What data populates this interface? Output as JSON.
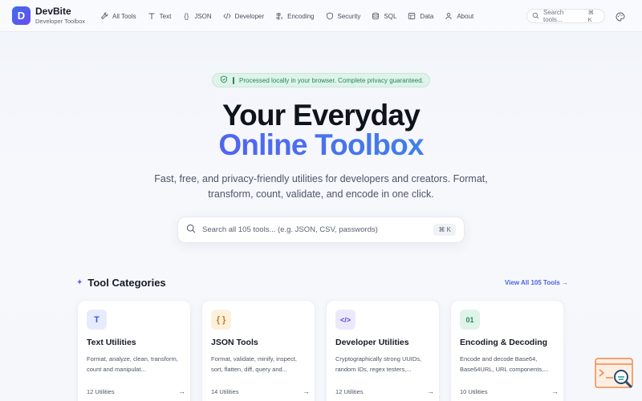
{
  "brand": {
    "logo_letter": "D",
    "name": "DevBite",
    "subtitle": "Developer Toolbox"
  },
  "nav": [
    {
      "label": "All Tools",
      "icon": "wrench-icon"
    },
    {
      "label": "Text",
      "icon": "text-icon"
    },
    {
      "label": "JSON",
      "icon": "braces-icon"
    },
    {
      "label": "Developer",
      "icon": "code-icon"
    },
    {
      "label": "Encoding",
      "icon": "binary-icon"
    },
    {
      "label": "Security",
      "icon": "shield-icon"
    },
    {
      "label": "SQL",
      "icon": "database-icon"
    },
    {
      "label": "Data",
      "icon": "table-icon"
    },
    {
      "label": "About",
      "icon": "user-icon"
    }
  ],
  "header_search": {
    "placeholder": "Search tools...",
    "shortcut": "⌘ K"
  },
  "hero": {
    "badge": "Processed locally in your browser. Complete privacy guaranteed.",
    "title_line1": "Your Everyday",
    "title_line2": "Online Toolbox",
    "subtitle": "Fast, free, and privacy-friendly utilities for developers and creators. Format, transform, count, validate, and encode in one click.",
    "search_placeholder": "Search all 105 tools... (e.g. JSON, CSV, passwords)",
    "search_shortcut": "⌘ K"
  },
  "categories": {
    "heading": "Tool Categories",
    "view_all": "View All 105 Tools →",
    "items": [
      {
        "glyph": "T",
        "title": "Text Utilities",
        "desc": "Format, analyze, clean, transform, count and manipulat...",
        "count": "12 Utilities",
        "icon_bg": "#e6ecfd",
        "icon_fg": "#3b5bdb"
      },
      {
        "glyph": "{ }",
        "title": "JSON Tools",
        "desc": "Format, validate, minify, inspect, sort, flatten, diff, query and...",
        "count": "14 Utilities",
        "icon_bg": "#fdf0dc",
        "icon_fg": "#c77d12"
      },
      {
        "glyph": "</>",
        "title": "Developer Utilities",
        "desc": "Cryptographically strong UUIDs, random IDs, regex testers,...",
        "count": "12 Utilities",
        "icon_bg": "#ece8fd",
        "icon_fg": "#5b46d8"
      },
      {
        "glyph": "01",
        "title": "Encoding & Decoding",
        "desc": "Encode and decode Base64, Base64URL, URL components,...",
        "count": "10 Utilities",
        "icon_bg": "#dff3ea",
        "icon_fg": "#1f8a5b"
      }
    ]
  },
  "colors": {
    "accent": "#4d63e8",
    "brand_gradient_start": "#3b6cf0",
    "brand_gradient_end": "#6a4cf0",
    "success": "#1f8a5b"
  }
}
